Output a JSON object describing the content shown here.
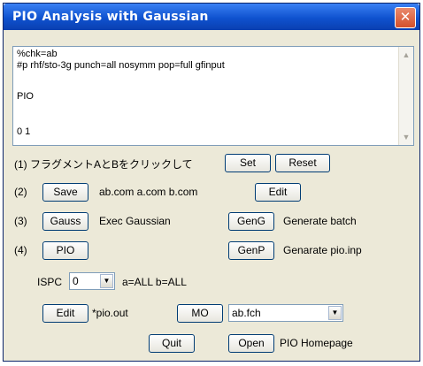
{
  "window": {
    "title": "PIO Analysis with Gaussian",
    "close_glyph": "✕"
  },
  "editor": {
    "lines": [
      "%chk=ab",
      "#p rhf/sto-3g punch=all nosymm pop=full gfinput",
      "",
      "PIO",
      "",
      "0 1"
    ],
    "scroll_up": "▲",
    "scroll_down": "▼"
  },
  "row1": {
    "label": "(1) フラグメントAとBをクリックして",
    "set": "Set",
    "reset": "Reset"
  },
  "row2": {
    "label": "(2)",
    "save": "Save",
    "files": "ab.com a.com b.com",
    "edit": "Edit"
  },
  "row3": {
    "label": "(3)",
    "gauss": "Gauss",
    "desc1": "Exec Gaussian",
    "geng": "GenG",
    "desc2": "Generate batch"
  },
  "row4": {
    "label": "(4)",
    "pio": "PIO",
    "genp": "GenP",
    "desc": "Genarate pio.inp"
  },
  "ispc": {
    "label": "ISPC",
    "value": "0",
    "info": "a=ALL b=ALL"
  },
  "row6": {
    "edit": "Edit",
    "file": "*pio.out",
    "mo": "MO",
    "fch_value": "ab.fch"
  },
  "row7": {
    "quit": "Quit",
    "open": "Open",
    "link": "PIO Homepage"
  }
}
